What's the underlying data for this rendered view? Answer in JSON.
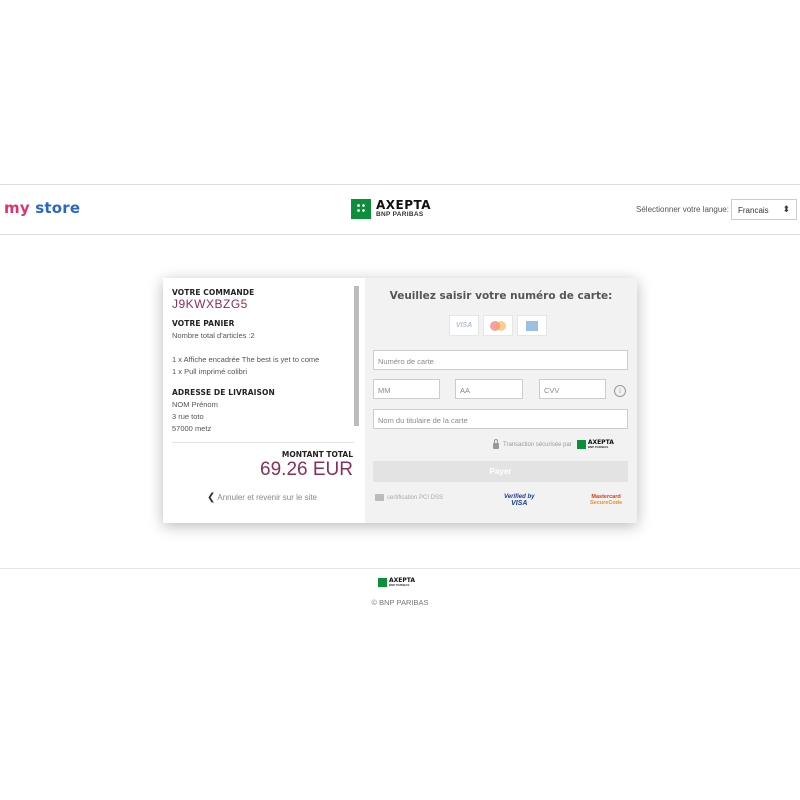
{
  "header": {
    "store_logo": {
      "part1": "my",
      "part2": "store"
    },
    "brand": {
      "name": "AXEPTA",
      "sub": "BNP PARIBAS"
    },
    "language_label": "Sélectionner votre langue:",
    "language_selected": "Francais",
    "select_arrow": "⬍"
  },
  "order": {
    "command_label": "VOTRE COMMANDE",
    "command_number": "J9KWXBZG5",
    "cart_label": "VOTRE PANIER",
    "item_count_text": "Nombre total d'articles :2",
    "items": [
      "1 x Affiche encadrée The best is yet to come",
      "1 x Pull imprimé colibri"
    ],
    "delivery_label": "ADRESSE DE LIVRAISON",
    "address_lines": [
      "NOM Prénom",
      "3 rue toto",
      "57000 metz"
    ],
    "total_label": "MONTANT TOTAL",
    "total_value": "69.26 EUR",
    "cancel_label": "Annuler et revenir sur le site"
  },
  "payment": {
    "title": "Veuillez saisir votre numéro de carte:",
    "card_brands": {
      "visa": "VISA",
      "mastercard": "mastercard-logo",
      "amex": "amex-logo"
    },
    "card_number_placeholder": "Numéro de carte",
    "month_placeholder": "MM",
    "year_placeholder": "AA",
    "cvv_placeholder": "CVV",
    "info_icon": "i",
    "holder_placeholder": "Nom du titulaire de la carte",
    "secure_text": "Transaction sécurisée par",
    "secure_brand": {
      "name": "AXEPTA",
      "sub": "BNP PARIBAS"
    },
    "pay_button": "Payer",
    "pci_text": "certification PCI DSS",
    "verified_visa": {
      "line1": "Verified by",
      "line2": "VISA"
    },
    "mastercard_securecode": {
      "line1": "Mastercard",
      "line2": "SecureCode"
    }
  },
  "footer": {
    "brand": {
      "name": "AXEPTA",
      "sub": "BNP PARIBAS"
    },
    "copyright": "© BNP PARIBAS"
  },
  "colors": {
    "accent": "#8a2e5c",
    "brand_green": "#0b8f3a",
    "store_pink": "#e0326e",
    "store_blue": "#2a66c8"
  }
}
